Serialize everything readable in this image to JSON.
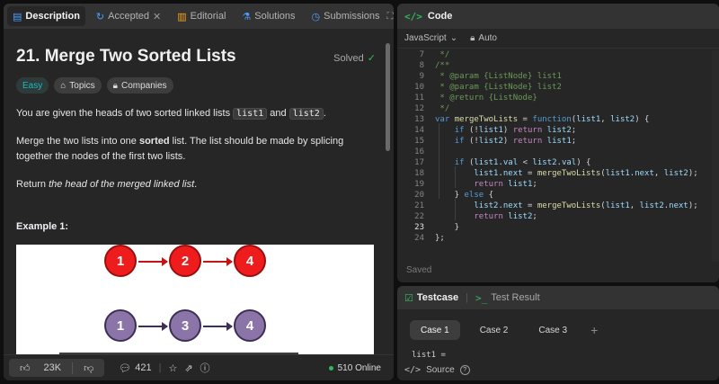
{
  "tabs": [
    {
      "label": "Description",
      "icon": "document-icon"
    },
    {
      "label": "Accepted",
      "icon": "history-icon"
    },
    {
      "label": "Editorial",
      "icon": "book-icon"
    },
    {
      "label": "Solutions",
      "icon": "flask-icon"
    },
    {
      "label": "Submissions",
      "icon": "clock-icon"
    }
  ],
  "problem": {
    "title": "21. Merge Two Sorted Lists",
    "status": "Solved",
    "difficulty": "Easy",
    "topics_label": "Topics",
    "companies_label": "Companies",
    "p1_a": "You are given the heads of two sorted linked lists ",
    "p1_code1": "list1",
    "p1_and": " and ",
    "p1_code2": "list2",
    "p1_end": ".",
    "p2_a": "Merge the two lists into one ",
    "p2_bold": "sorted",
    "p2_b": " list. The list should be made by splicing together the nodes of the first two lists.",
    "p3_a": "Return ",
    "p3_em": "the head of the merged linked list",
    "p3_end": ".",
    "example_title": "Example 1:",
    "list1_nodes": [
      "1",
      "2",
      "4"
    ],
    "list2_nodes": [
      "1",
      "3",
      "4"
    ]
  },
  "footer": {
    "likes": "23K",
    "comments": "421",
    "online": "510 Online"
  },
  "code_panel": {
    "title": "Code",
    "language": "JavaScript",
    "mode": "Auto",
    "saved": "Saved",
    "lines": [
      {
        "n": "7",
        "t": " */"
      },
      {
        "n": "8",
        "t": "/**"
      },
      {
        "n": "9",
        "t": " * @param {ListNode} list1"
      },
      {
        "n": "10",
        "t": " * @param {ListNode} list2"
      },
      {
        "n": "11",
        "t": " * @return {ListNode}"
      },
      {
        "n": "12",
        "t": " */"
      },
      {
        "n": "13",
        "t": "var mergeTwoLists = function(list1, list2) {"
      },
      {
        "n": "14",
        "t": "    if (!list1) return list2;"
      },
      {
        "n": "15",
        "t": "    if (!list2) return list1;"
      },
      {
        "n": "16",
        "t": ""
      },
      {
        "n": "17",
        "t": "    if (list1.val < list2.val) {"
      },
      {
        "n": "18",
        "t": "        list1.next = mergeTwoLists(list1.next, list2);"
      },
      {
        "n": "19",
        "t": "        return list1;"
      },
      {
        "n": "20",
        "t": "    } else {"
      },
      {
        "n": "21",
        "t": "        list2.next = mergeTwoLists(list1, list2.next);"
      },
      {
        "n": "22",
        "t": "        return list2;"
      },
      {
        "n": "23",
        "t": "    }"
      },
      {
        "n": "24",
        "t": "};"
      }
    ]
  },
  "test_panel": {
    "testcase_label": "Testcase",
    "result_label": "Test Result",
    "cases": [
      "Case 1",
      "Case 2",
      "Case 3"
    ],
    "input_label": "list1 =",
    "source_label": "Source"
  }
}
